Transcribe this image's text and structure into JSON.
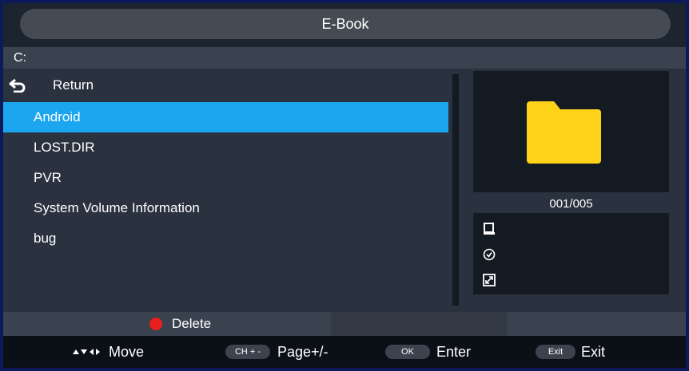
{
  "title": "E-Book",
  "path": "C:",
  "return_label": "Return",
  "items": [
    {
      "label": "Android",
      "selected": true
    },
    {
      "label": "LOST.DIR"
    },
    {
      "label": "PVR"
    },
    {
      "label": "System Volume Information"
    },
    {
      "label": "bug"
    }
  ],
  "preview": {
    "icon": "folder-icon",
    "folder_color": "#ffd21a"
  },
  "page_counter": "001/005",
  "info_icons": [
    "document-icon",
    "clock-icon",
    "resize-icon"
  ],
  "delete_label": "Delete",
  "hints": {
    "move_label": "Move",
    "ch_key": "CH + -",
    "page_label": "Page+/-",
    "ok_key": "OK",
    "enter_label": "Enter",
    "exit_key": "Exit",
    "exit_label": "Exit"
  },
  "colors": {
    "selection": "#1ca6f0",
    "delete_dot": "#e81f1f"
  }
}
